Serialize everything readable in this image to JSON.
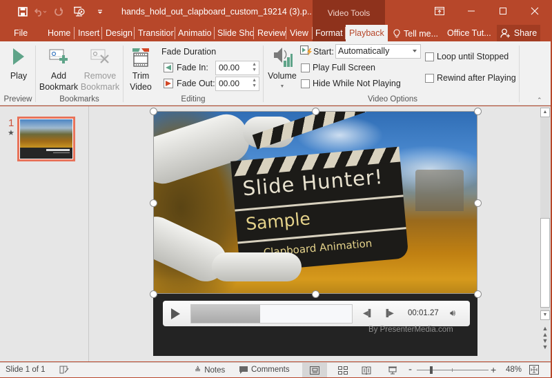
{
  "titlebar": {
    "doc_title": "hands_hold_out_clapboard_custom_19214 (3).p...",
    "context_group": "Video Tools",
    "qat_icons": [
      "save-icon",
      "undo-icon",
      "redo-icon",
      "present-from-start-icon",
      "customize-qat-icon"
    ],
    "window_controls": [
      "ribbon-display-options-icon",
      "minimize-icon",
      "maximize-icon",
      "close-icon"
    ]
  },
  "tabs": [
    {
      "label": "File"
    },
    {
      "label": "Home"
    },
    {
      "label": "Insert"
    },
    {
      "label": "Design"
    },
    {
      "label": "Transition"
    },
    {
      "label": "Animatio"
    },
    {
      "label": "Slide Sho"
    },
    {
      "label": "Review"
    },
    {
      "label": "View"
    },
    {
      "label": "Format"
    },
    {
      "label": "Playback",
      "active": true
    },
    {
      "label": "Tell me..."
    },
    {
      "label": "Office Tut..."
    }
  ],
  "share_label": "Share",
  "ribbon": {
    "preview": {
      "label": "Preview",
      "play": "Play"
    },
    "bookmarks": {
      "label": "Bookmarks",
      "add_1": "Add",
      "add_2": "Bookmark",
      "remove_1": "Remove",
      "remove_2": "Bookmark"
    },
    "editing": {
      "label": "Editing",
      "trim_1": "Trim",
      "trim_2": "Video",
      "fade_duration": "Fade Duration",
      "fade_in_label": "Fade In:",
      "fade_in_value": "00.00",
      "fade_out_label": "Fade Out:",
      "fade_out_value": "00.00"
    },
    "video_options": {
      "label": "Video Options",
      "volume": "Volume",
      "start_label": "Start:",
      "start_value": "Automatically",
      "play_full_screen": "Play Full Screen",
      "hide_while_not_playing": "Hide While Not Playing",
      "loop_until_stopped": "Loop until Stopped",
      "rewind_after_playing": "Rewind after Playing",
      "checks": {
        "play_full_screen": false,
        "hide_while_not_playing": false,
        "loop_until_stopped": false,
        "rewind_after_playing": false
      }
    }
  },
  "thumbnails": [
    {
      "number": "1",
      "has_animation_star": true,
      "selected": true
    }
  ],
  "slide": {
    "video_text": {
      "title": "Slide Hunter!",
      "line2": "Sample",
      "line3": "Clapboard Animation"
    },
    "player": {
      "time": "00:01.27",
      "progress": 0.43
    },
    "credit": "By PresenterMedia.com"
  },
  "statusbar": {
    "slide_info": "Slide 1 of 1",
    "notes": "Notes",
    "comments": "Comments",
    "zoom": "48%",
    "zoom_value": 48
  }
}
